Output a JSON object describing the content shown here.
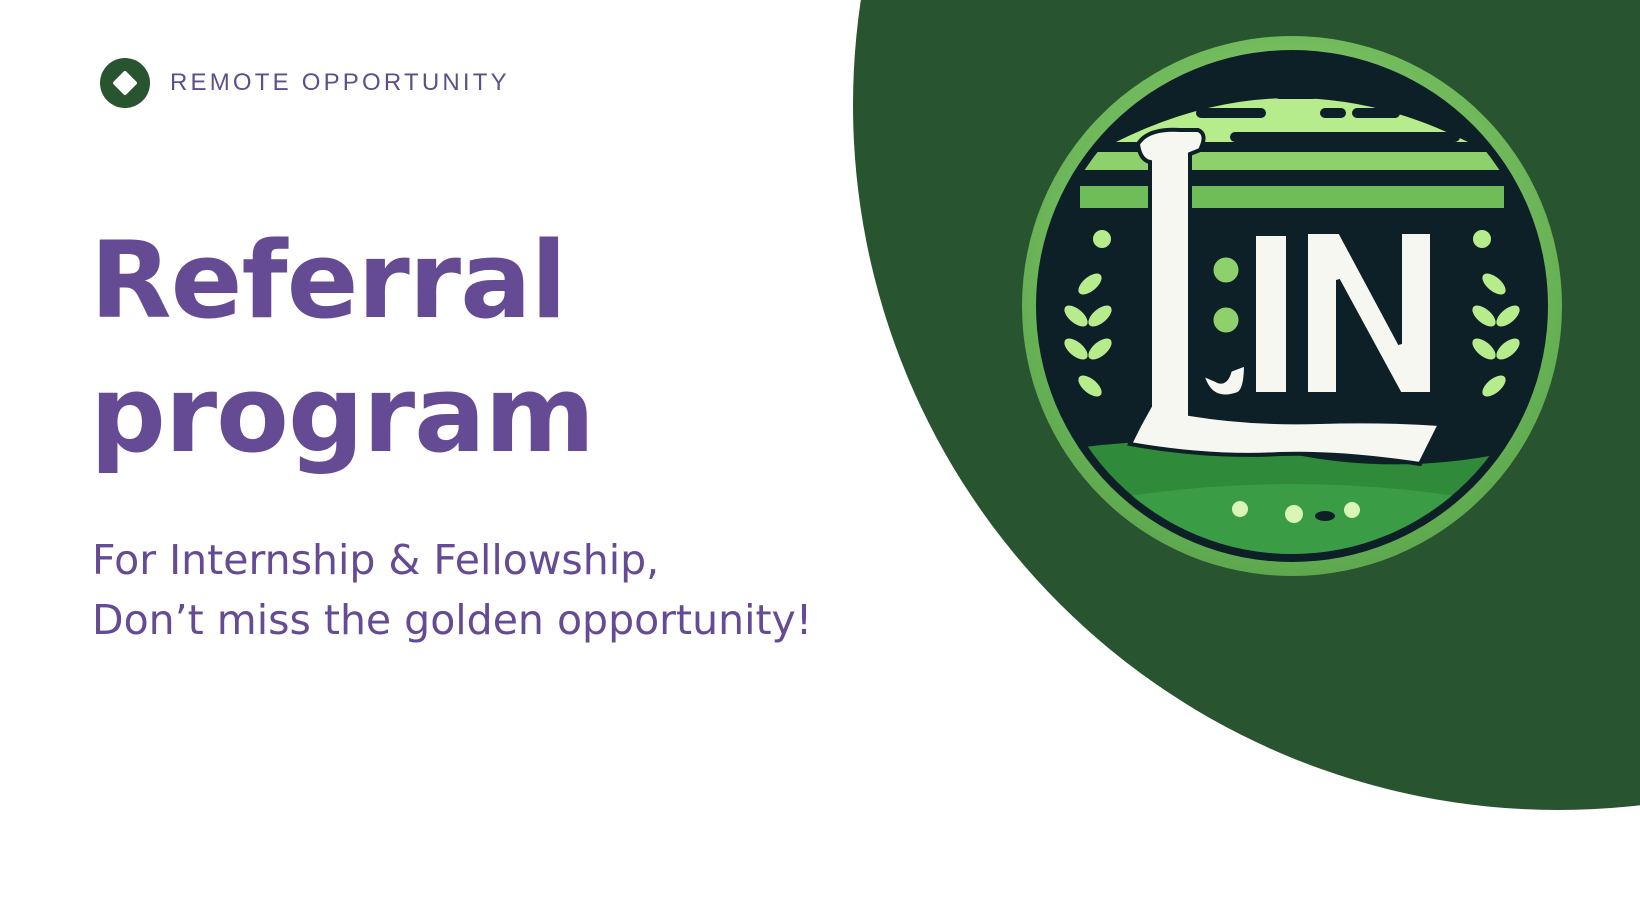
{
  "tag": {
    "text": "REMOTE OPPORTUNITY",
    "icon": "diamond-badge-icon"
  },
  "title": {
    "line1": "Referral",
    "line2": "program"
  },
  "subtitle": {
    "line1": "For Internship & Fellowship,",
    "line2": "Don’t miss the golden opportunity!"
  },
  "logo": {
    "icon": "lin-emblem-logo",
    "lettering": "LIN"
  },
  "colors": {
    "title_purple": "#644b94",
    "tag_purple": "#5e4f8a",
    "dark_green": "#285530",
    "light_green": "#7cc86a",
    "emblem_navy": "#0d2028"
  }
}
